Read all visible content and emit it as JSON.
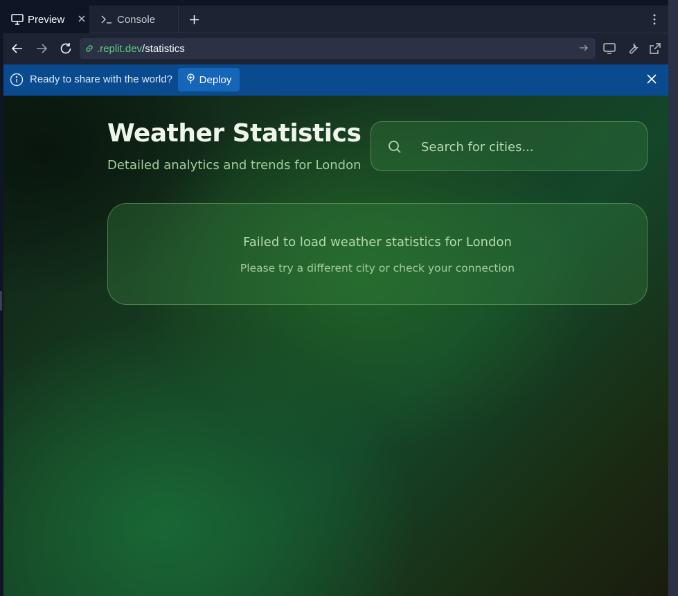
{
  "tabs": [
    {
      "label": "Preview",
      "icon": "monitor-icon",
      "active": true
    },
    {
      "label": "Console",
      "icon": "terminal-icon",
      "active": false
    }
  ],
  "address": {
    "domain": ".replit.dev",
    "path": "/statistics"
  },
  "banner": {
    "text": "Ready to share with the world?",
    "deploy_label": "Deploy"
  },
  "app": {
    "title": "Weather Statistics",
    "subtitle": "Detailed analytics and trends for London",
    "search_placeholder": "Search for cities...",
    "error_title": "Failed to load weather statistics for London",
    "error_hint": "Please try a different city or check your connection"
  },
  "colors": {
    "frame_bg": "#1c2333",
    "banner_bg": "#0a4a8f",
    "deploy_bg": "#1565b8",
    "url_domain": "#5bd27d",
    "app_title": "#eef6ea",
    "app_subtitle": "#9fd19a"
  }
}
